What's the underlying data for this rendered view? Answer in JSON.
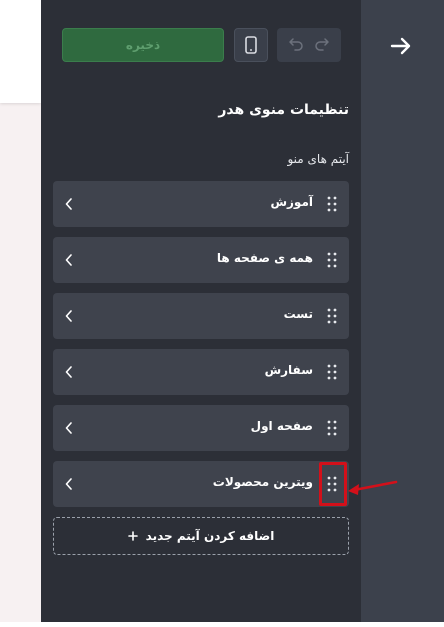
{
  "toolbar": {
    "save_label": "ذخیره",
    "device_icon": "mobile-icon",
    "undo_icon": "undo-icon",
    "redo_icon": "redo-icon"
  },
  "rail": {
    "back_icon": "arrow-right-icon"
  },
  "panel": {
    "title": "تنظیمات منوی هدر",
    "section_label": "آیتم های منو",
    "items": [
      {
        "label": "آموزش"
      },
      {
        "label": "همه ی صفحه ها"
      },
      {
        "label": "تست"
      },
      {
        "label": "سفارش"
      },
      {
        "label": "صفحه اول"
      },
      {
        "label": "ویترین محصولات"
      }
    ],
    "add_button_label": "اضافه کردن آیتم جدید",
    "add_icon": "plus-icon"
  },
  "colors": {
    "panel_bg": "#2c2f37",
    "item_bg": "#3f434d",
    "save_green": "#2f6a3f",
    "annotation_red": "#d3101a"
  }
}
